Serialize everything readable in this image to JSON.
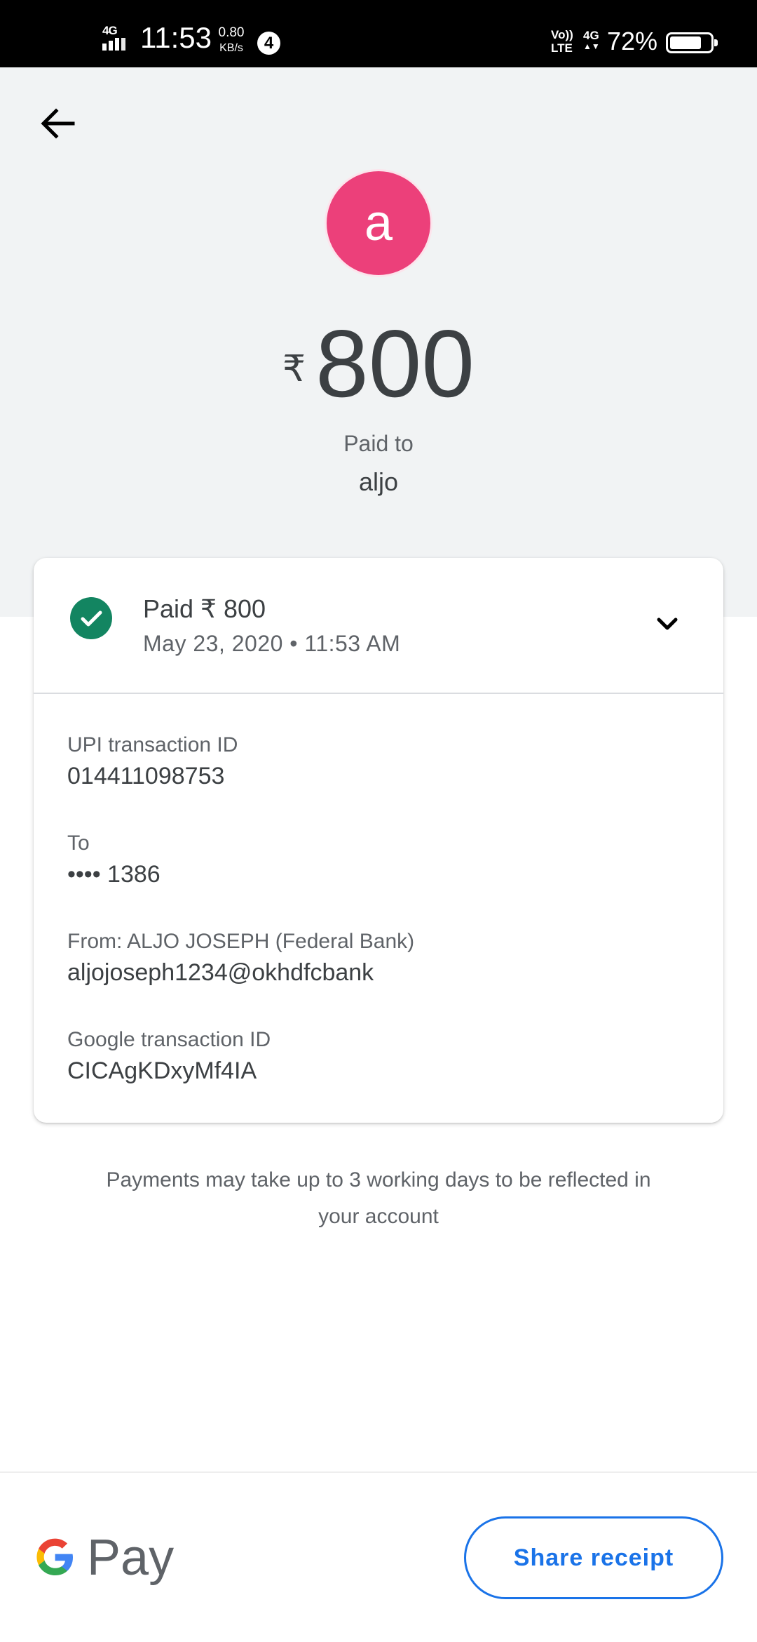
{
  "status_bar": {
    "network": "4G",
    "time": "11:53",
    "speed_value": "0.80",
    "speed_unit": "KB/s",
    "notification_count": "4",
    "volte": "Vo)) LTE",
    "network2": "4G",
    "battery": "72%",
    "battery_level": 0.72
  },
  "header": {
    "avatar_letter": "a",
    "avatar_color": "#ec407a",
    "currency": "₹",
    "amount": "800",
    "paid_to_label": "Paid to",
    "payee": "aljo"
  },
  "card": {
    "status_title": "Paid ₹ 800",
    "status_time": "May 23, 2020 • 11:53 AM",
    "status_color": "#138561",
    "details": [
      {
        "label": "UPI transaction ID",
        "value": "014411098753"
      },
      {
        "label": "To",
        "value": "•••• 1386"
      },
      {
        "label": "From: ALJO JOSEPH (Federal Bank)",
        "value": "aljojoseph1234@okhdfcbank"
      },
      {
        "label": "Google transaction ID",
        "value": "CICAgKDxyMf4IA"
      }
    ]
  },
  "notice": "Payments may take up to 3 working days to be reflected in your account",
  "footer": {
    "brand": "Pay",
    "share_label": "Share receipt",
    "accent": "#1a73e8"
  },
  "icons": {
    "back": "arrow-left-icon",
    "check": "check-circle-icon",
    "expand": "chevron-down-icon",
    "logo": "google-g-icon"
  }
}
